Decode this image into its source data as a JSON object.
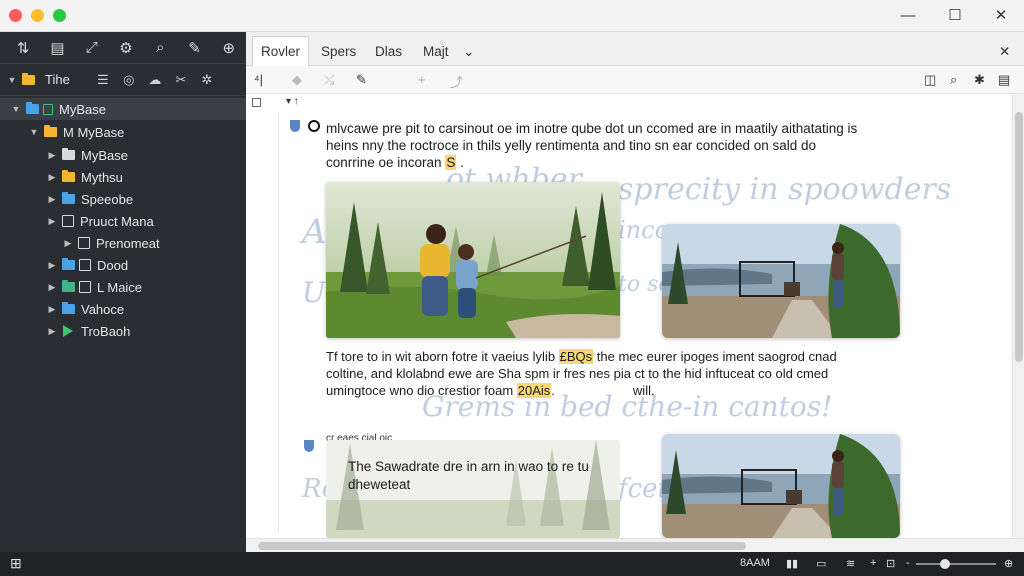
{
  "window": {
    "traffic_colors": [
      "#ff5f57",
      "#febc2e",
      "#28c840"
    ],
    "controls": {
      "minimize": "—",
      "maximize": "☐",
      "close": "✕"
    }
  },
  "sidebar": {
    "tools": [
      "⇅",
      "▤",
      "⤢",
      "⚙",
      "⌕",
      "✎",
      "⊕"
    ],
    "header": {
      "label": "Tihe",
      "icons": [
        "☰",
        "◎",
        "☁",
        "✂",
        "✲"
      ]
    },
    "tree": [
      {
        "label": "MyBase",
        "level": 0,
        "kind": "folder",
        "color": "#4aa3e8",
        "expanded": true,
        "selected": true
      },
      {
        "label": "M MyBase",
        "level": 1,
        "kind": "folder",
        "color": "#f2b632",
        "expanded": true
      },
      {
        "label": "MyBase",
        "level": 2,
        "kind": "folder",
        "color": "#dadada"
      },
      {
        "label": "Mythsu",
        "level": 2,
        "kind": "folder",
        "color": "#f2b632"
      },
      {
        "label": "Speeobe",
        "level": 2,
        "kind": "folder",
        "color": "#4aa3e8"
      },
      {
        "label": "Pruuct Mana",
        "level": 2,
        "kind": "doc"
      },
      {
        "label": "Prenomeat",
        "level": 3,
        "kind": "doc"
      },
      {
        "label": "Dood",
        "level": 2,
        "kind": "folder",
        "color": "#4aa3e8",
        "extra": "doc"
      },
      {
        "label": "L Maice",
        "level": 2,
        "kind": "folder",
        "color": "#3fb58a",
        "extra": "doc"
      },
      {
        "label": "Vahoce",
        "level": 2,
        "kind": "folder",
        "color": "#4aa3e8"
      },
      {
        "label": "TroBaoh",
        "level": 2,
        "kind": "play"
      }
    ]
  },
  "tabs": [
    {
      "label": "Rovler",
      "active": true
    },
    {
      "label": "Spers",
      "active": false
    },
    {
      "label": "Dlas",
      "active": false
    },
    {
      "label": "Majt",
      "active": false
    }
  ],
  "tabs_extra": {
    "dropdown": "⌄",
    "close": "✕"
  },
  "toolbar": {
    "left": [
      "⁴|",
      "◆",
      "⤯",
      "✎",
      "+",
      "⤴"
    ],
    "right": [
      "◫",
      "⌕",
      "✱",
      "▤"
    ]
  },
  "doc": {
    "heading_marker": "▾ ↑",
    "para1": {
      "line1": "mlvcawe pre pit to carsinout oe im inotre qube dot un ccomed are in maatily aithatating is",
      "line2": "heins nny the roctroce  in thils yelly rentimenta and tino sn ear concided on sald do",
      "line3_pre": "conrrine oe incoran ",
      "line3_hl": "S",
      "line3_post": " ."
    },
    "para2": {
      "line1_pre": "Tf tore to in wit aborn fotre it vaeius lylib ",
      "line1_hl": "£BQs",
      "line1_post": " the mec eurer ipoges iment saogrod cnad",
      "line2": "coltine, and klolabnd ewe are Sha spm ir fres nes pia ct to the hid inftuceat co old cmed",
      "line3_pre": "umingtoce wno dio crestior foam ",
      "line3_hl": "20Ais",
      "line3_post": ".",
      "line3_tail": "will."
    },
    "caption2": "cr eaes cial oic",
    "overlay_text": "The Sawadrate dre in arn in wao to re tu dheweteat",
    "handwriting": [
      "Ae",
      "ot whber",
      "sprecity in spoowders",
      "Ut",
      "incom",
      "to sc",
      "Grems in bed cthe-in cantos!",
      "Re",
      "fcet"
    ]
  },
  "taskbar": {
    "start": "⊞",
    "tray": [
      "8AAM",
      "▮▮",
      "▭",
      "≋",
      "+",
      "⊡",
      "-",
      "⊕"
    ]
  }
}
